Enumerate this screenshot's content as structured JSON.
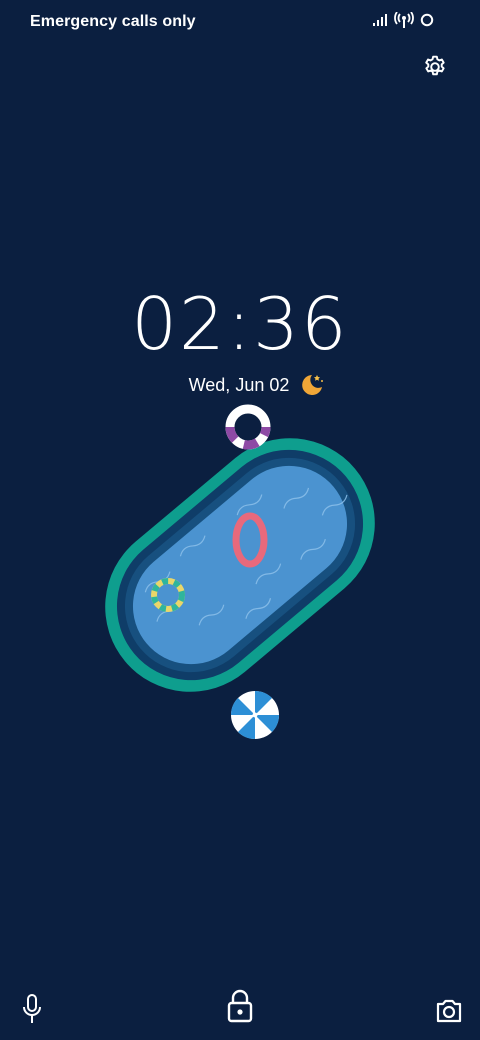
{
  "status_bar": {
    "carrier_text": "Emergency calls only",
    "icons": [
      "signal-icon",
      "hotspot-icon",
      "ring-icon"
    ]
  },
  "lock_screen": {
    "time": "02:36",
    "date": "Wed, Jun 02",
    "weather_icon": "moon-stars-icon"
  },
  "bottom_bar": {
    "left": "microphone-icon",
    "center": "lock-icon",
    "right": "camera-icon"
  },
  "colors": {
    "background": "#0b1f40",
    "pool_outer": "#0e9e8e",
    "pool_water": "#4b93d0",
    "text": "#ffffff",
    "moon": "#f0a637"
  }
}
